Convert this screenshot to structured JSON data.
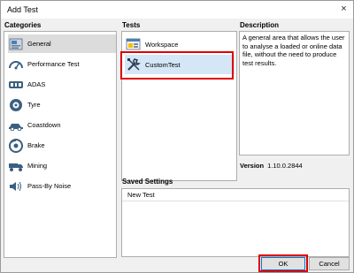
{
  "window": {
    "title": "Add Test",
    "close_glyph": "×"
  },
  "categories": {
    "heading": "Categories",
    "items": [
      {
        "label": "General",
        "icon": "general-icon",
        "selected": true
      },
      {
        "label": "Performance Test",
        "icon": "speedometer-icon"
      },
      {
        "label": "ADAS",
        "icon": "adas-icon"
      },
      {
        "label": "Tyre",
        "icon": "tyre-icon"
      },
      {
        "label": "Coastdown",
        "icon": "car-icon"
      },
      {
        "label": "Brake",
        "icon": "brake-icon"
      },
      {
        "label": "Mining",
        "icon": "mining-truck-icon"
      },
      {
        "label": "Pass-By Noise",
        "icon": "speaker-icon"
      }
    ]
  },
  "tests": {
    "heading": "Tests",
    "items": [
      {
        "label": "Workspace",
        "icon": "workspace-icon"
      },
      {
        "label": "CustomTest",
        "icon": "wrench-screwdriver-icon",
        "selected": true
      }
    ]
  },
  "description": {
    "heading": "Description",
    "text": "A general area that allows the user to analyse a loaded or online data file, without the need to produce test results."
  },
  "version": {
    "label": "Version",
    "value": "1.10.0.2844"
  },
  "saved_settings": {
    "heading": "Saved Settings",
    "items": [
      "New Test"
    ]
  },
  "buttons": {
    "ok": "OK",
    "cancel": "Cancel"
  },
  "colors": {
    "highlight": "#e00000",
    "selection_blue": "#d5e7f7",
    "selection_grey": "#dcdcdc",
    "focus_blue": "#0078d7"
  }
}
